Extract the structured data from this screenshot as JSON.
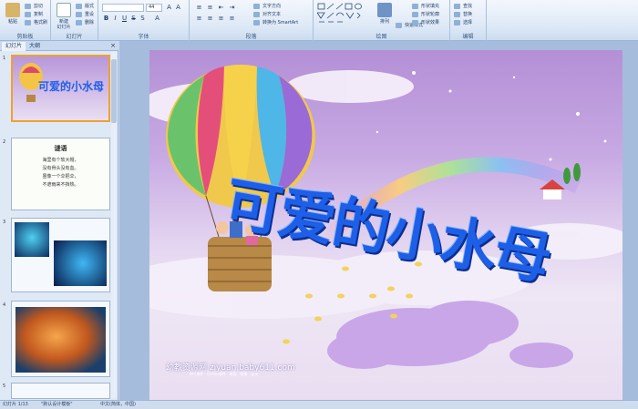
{
  "ribbon": {
    "clipboard": {
      "paste": "粘贴",
      "cut": "剪切",
      "copy": "复制",
      "painter": "格式刷",
      "label": "剪贴板"
    },
    "slides": {
      "new_slide": "新建\n幻灯片",
      "layout": "版式",
      "reset": "重设",
      "delete": "删除",
      "label": "幻灯片"
    },
    "font": {
      "font_name": "",
      "font_size": "44",
      "label": "字体"
    },
    "paragraph": {
      "text_direction": "文字方向",
      "align_text": "对齐文本",
      "smartart": "转换为 SmartArt",
      "label": "段落"
    },
    "drawing": {
      "arrange": "排列",
      "quick_styles": "快速样式",
      "shape_fill": "形状填充",
      "shape_outline": "形状轮廓",
      "shape_effects": "形状效果",
      "label": "绘图"
    },
    "editing": {
      "find": "查找",
      "replace": "替换",
      "select": "选择",
      "label": "编辑"
    }
  },
  "panel": {
    "tab_slides": "幻灯片",
    "tab_outline": "大纲"
  },
  "thumbs": [
    {
      "num": "1",
      "title": "可爱的小水母"
    },
    {
      "num": "2",
      "title": "谜语",
      "lines": [
        "海里有个软大帽，",
        "没有骨头没有血。",
        "虽像一个伞把伞，",
        "不遮雨来不挡热。"
      ]
    },
    {
      "num": "3"
    },
    {
      "num": "4"
    },
    {
      "num": "5"
    }
  ],
  "slide": {
    "title": "可爱的小水母",
    "watermark": "幼教资源网 ziyuan.baby611.com",
    "watermark_sub": "PPT课件 · FLASH课件 · 教案 · 故事 · 论文"
  },
  "status": {
    "slide_count": "幻灯片 1/13",
    "theme": "\"默认设计模板\"",
    "lang": "中文(简体，中国)"
  },
  "colors": {
    "title_blue": "#1e5fe8",
    "selected_border": "#f0a030",
    "ribbon_bg": "#dce8f6"
  }
}
